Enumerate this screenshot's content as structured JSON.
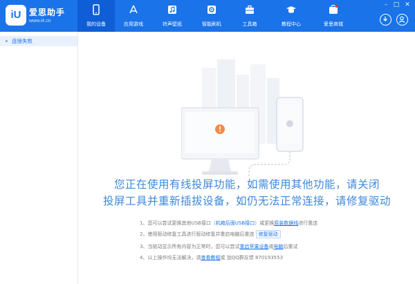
{
  "header": {
    "logo_text": "iU",
    "brand": "爱思助手",
    "url": "www.i4.cn",
    "nav": [
      {
        "label": "我的设备",
        "icon": "phone-icon",
        "active": true
      },
      {
        "label": "应用游戏",
        "icon": "app-store-icon",
        "active": false
      },
      {
        "label": "铃声壁纸",
        "icon": "music-note-icon",
        "active": false
      },
      {
        "label": "智能刷机",
        "icon": "flash-gear-icon",
        "active": false
      },
      {
        "label": "工具箱",
        "icon": "toolbox-icon",
        "active": false
      },
      {
        "label": "教程中心",
        "icon": "graduation-cap-icon",
        "active": false
      },
      {
        "label": "爱思商城",
        "icon": "shop-icon",
        "active": false
      }
    ],
    "window_controls": [
      "minimize-icon",
      "maximize-icon",
      "close-icon"
    ],
    "right_icons": [
      "download-icon",
      "user-icon"
    ]
  },
  "sidebar": {
    "items": [
      {
        "label": "连接失败"
      }
    ]
  },
  "main": {
    "message_line1": "您正在使用有线投屏功能，如需使用其他功能，请关闭",
    "message_line2": "投屏工具并重新插拔设备，如仍无法正常连接，请修复驱动",
    "tips": {
      "t1_prefix": "1、您可以尝试更换其他USB接口（",
      "t1_link1": "机箱后面USB接口",
      "t1_mid": "）或更换",
      "t1_link2": "原装数据线",
      "t1_suffix": "进行重连",
      "t2_prefix": "2、使用驱动修复工具进行驱动修复并重启电脑后重连",
      "t2_button": "修复驱动",
      "t3_prefix": "3、当驱动显示所有内容为正常时，您可以尝试",
      "t3_link1": "重启苹果设备",
      "t3_mid": "或",
      "t3_link2": "电脑",
      "t3_suffix": "后重试",
      "t4_prefix": "4、以上操作均无法解决，请",
      "t4_link": "查看教程",
      "t4_suffix": "或 加QQ群反馈 870193553"
    }
  },
  "colors": {
    "accent": "#1a73e8",
    "header_bg": "#1a73e8",
    "active_tab": "#0f5ed6",
    "message": "#3d88db"
  }
}
